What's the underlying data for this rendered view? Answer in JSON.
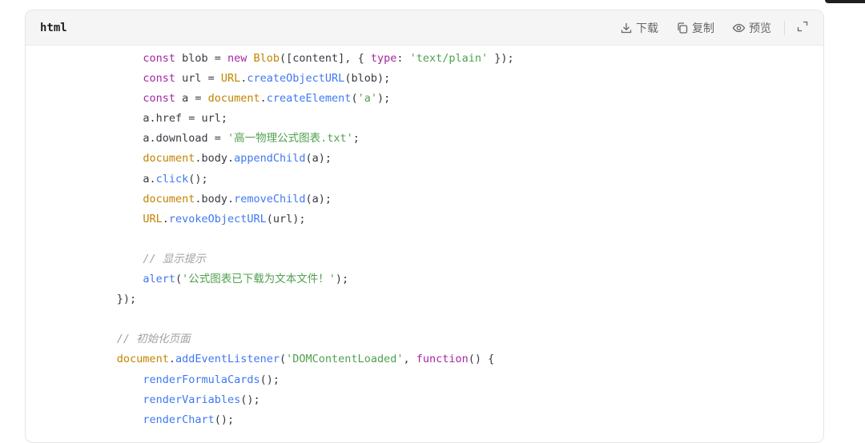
{
  "header": {
    "language": "html",
    "actions": {
      "download": "下载",
      "copy": "复制",
      "preview": "预览"
    }
  },
  "code_lines": [
    {
      "indent": "        ",
      "tokens": [
        {
          "t": "keyword",
          "v": "const"
        },
        {
          "t": "plain",
          "v": " blob = "
        },
        {
          "t": "keyword",
          "v": "new"
        },
        {
          "t": "plain",
          "v": " "
        },
        {
          "t": "builtin",
          "v": "Blob"
        },
        {
          "t": "plain",
          "v": "([content], { "
        },
        {
          "t": "keyword",
          "v": "type"
        },
        {
          "t": "plain",
          "v": ": "
        },
        {
          "t": "str",
          "v": "'text/plain'"
        },
        {
          "t": "plain",
          "v": " });"
        }
      ]
    },
    {
      "indent": "        ",
      "tokens": [
        {
          "t": "keyword",
          "v": "const"
        },
        {
          "t": "plain",
          "v": " url = "
        },
        {
          "t": "builtin",
          "v": "URL"
        },
        {
          "t": "plain",
          "v": "."
        },
        {
          "t": "func",
          "v": "createObjectURL"
        },
        {
          "t": "plain",
          "v": "(blob);"
        }
      ]
    },
    {
      "indent": "        ",
      "tokens": [
        {
          "t": "keyword",
          "v": "const"
        },
        {
          "t": "plain",
          "v": " a = "
        },
        {
          "t": "builtin",
          "v": "document"
        },
        {
          "t": "plain",
          "v": "."
        },
        {
          "t": "func",
          "v": "createElement"
        },
        {
          "t": "plain",
          "v": "("
        },
        {
          "t": "str",
          "v": "'a'"
        },
        {
          "t": "plain",
          "v": ");"
        }
      ]
    },
    {
      "indent": "        ",
      "tokens": [
        {
          "t": "plain",
          "v": "a.href = url;"
        }
      ]
    },
    {
      "indent": "        ",
      "tokens": [
        {
          "t": "plain",
          "v": "a.download = "
        },
        {
          "t": "str",
          "v": "'高一物理公式图表.txt'"
        },
        {
          "t": "plain",
          "v": ";"
        }
      ]
    },
    {
      "indent": "        ",
      "tokens": [
        {
          "t": "builtin",
          "v": "document"
        },
        {
          "t": "plain",
          "v": ".body."
        },
        {
          "t": "func",
          "v": "appendChild"
        },
        {
          "t": "plain",
          "v": "(a);"
        }
      ]
    },
    {
      "indent": "        ",
      "tokens": [
        {
          "t": "plain",
          "v": "a."
        },
        {
          "t": "func",
          "v": "click"
        },
        {
          "t": "plain",
          "v": "();"
        }
      ]
    },
    {
      "indent": "        ",
      "tokens": [
        {
          "t": "builtin",
          "v": "document"
        },
        {
          "t": "plain",
          "v": ".body."
        },
        {
          "t": "func",
          "v": "removeChild"
        },
        {
          "t": "plain",
          "v": "(a);"
        }
      ]
    },
    {
      "indent": "        ",
      "tokens": [
        {
          "t": "builtin",
          "v": "URL"
        },
        {
          "t": "plain",
          "v": "."
        },
        {
          "t": "func",
          "v": "revokeObjectURL"
        },
        {
          "t": "plain",
          "v": "(url);"
        }
      ]
    },
    {
      "indent": "",
      "tokens": []
    },
    {
      "indent": "        ",
      "tokens": [
        {
          "t": "comment",
          "v": "// 显示提示"
        }
      ]
    },
    {
      "indent": "        ",
      "tokens": [
        {
          "t": "func",
          "v": "alert"
        },
        {
          "t": "plain",
          "v": "("
        },
        {
          "t": "str",
          "v": "'公式图表已下载为文本文件！'"
        },
        {
          "t": "plain",
          "v": ");"
        }
      ]
    },
    {
      "indent": "    ",
      "tokens": [
        {
          "t": "plain",
          "v": "});"
        }
      ]
    },
    {
      "indent": "",
      "tokens": []
    },
    {
      "indent": "    ",
      "tokens": [
        {
          "t": "comment",
          "v": "// 初始化页面"
        }
      ]
    },
    {
      "indent": "    ",
      "tokens": [
        {
          "t": "builtin",
          "v": "document"
        },
        {
          "t": "plain",
          "v": "."
        },
        {
          "t": "func",
          "v": "addEventListener"
        },
        {
          "t": "plain",
          "v": "("
        },
        {
          "t": "str",
          "v": "'DOMContentLoaded'"
        },
        {
          "t": "plain",
          "v": ", "
        },
        {
          "t": "keyword",
          "v": "function"
        },
        {
          "t": "plain",
          "v": "() {"
        }
      ]
    },
    {
      "indent": "        ",
      "tokens": [
        {
          "t": "func",
          "v": "renderFormulaCards"
        },
        {
          "t": "plain",
          "v": "();"
        }
      ]
    },
    {
      "indent": "        ",
      "tokens": [
        {
          "t": "func",
          "v": "renderVariables"
        },
        {
          "t": "plain",
          "v": "();"
        }
      ]
    },
    {
      "indent": "        ",
      "tokens": [
        {
          "t": "func",
          "v": "renderChart"
        },
        {
          "t": "plain",
          "v": "();"
        }
      ]
    }
  ]
}
